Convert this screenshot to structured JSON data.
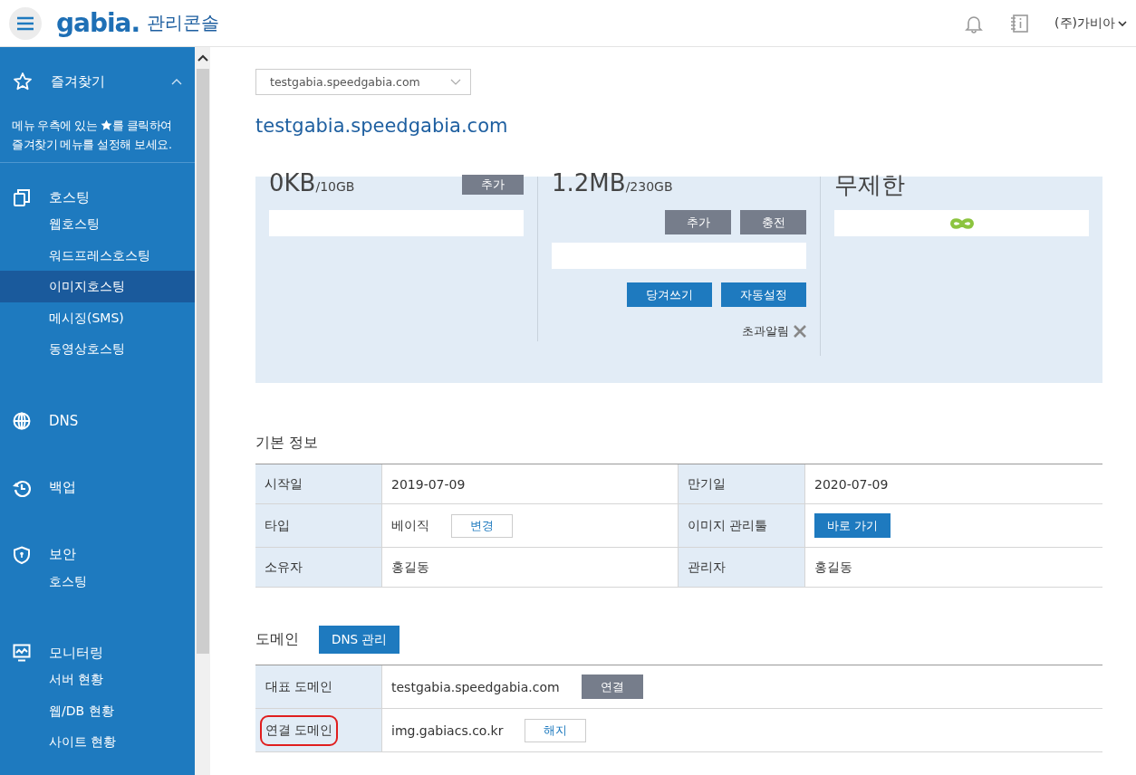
{
  "header": {
    "logo": "gabia.",
    "title": "관리콘솔",
    "user": "(주)가비아"
  },
  "sidebar": {
    "favorites": {
      "label": "즐겨찾기",
      "expanded": true,
      "hint_before": "메뉴 우측에 있는 ",
      "hint_after": "를 클릭하여 즐겨찾기 메뉴를 설정해 보세요."
    },
    "groups": [
      {
        "kind": "hosting",
        "label": "호스팅",
        "items": [
          {
            "label": "웹호스팅",
            "selected": false
          },
          {
            "label": "워드프레스호스팅",
            "selected": false
          },
          {
            "label": "이미지호스팅",
            "selected": true
          },
          {
            "label": "메시징(SMS)",
            "selected": false
          },
          {
            "label": "동영상호스팅",
            "selected": false
          }
        ]
      },
      {
        "kind": "globe",
        "label": "DNS"
      },
      {
        "kind": "history",
        "label": "백업"
      },
      {
        "kind": "shield",
        "label": "보안",
        "items": [
          {
            "label": "호스팅",
            "selected": false
          }
        ]
      },
      {
        "kind": "monitor",
        "label": "모니터링",
        "items": [
          {
            "label": "서버 현황",
            "selected": false
          },
          {
            "label": "웹/DB 현황",
            "selected": false
          },
          {
            "label": "사이트 현황",
            "selected": false
          }
        ]
      }
    ]
  },
  "site_select": {
    "value": "testgabia.speedgabia.com"
  },
  "page_title": "testgabia.speedgabia.com",
  "usage": [
    {
      "amount": "0KB",
      "total": "/10GB",
      "buttons_top": [
        "추가"
      ],
      "kind": "bar"
    },
    {
      "amount": "1.2MB",
      "total": "/230GB",
      "kind": "bar",
      "actions": [
        "추가",
        "충전"
      ],
      "buttons": [
        "당겨쓰기",
        "자동설정"
      ],
      "note": "초과알림"
    },
    {
      "amount": "무제한",
      "kind": "infinite"
    }
  ],
  "basic_info": {
    "title": "기본 정보",
    "rows": [
      [
        {
          "label": "시작일",
          "value": "2019-07-09"
        },
        {
          "label": "만기일",
          "value": "2020-07-09"
        }
      ],
      [
        {
          "label": "타입",
          "value": "베이직",
          "button": "변경",
          "kind": "outline"
        },
        {
          "label": "이미지 관리툴",
          "button": "바로 가기",
          "kind": "primary"
        }
      ],
      [
        {
          "label": "소유자",
          "value": "홍길동"
        },
        {
          "label": "관리자",
          "value": "홍길동"
        }
      ]
    ]
  },
  "domain": {
    "title": "도메인",
    "button": "DNS 관리",
    "rows": [
      {
        "label": "대표 도메인",
        "value": "testgabia.speedgabia.com",
        "button": "연결",
        "kind": "dark",
        "highlighted": false
      },
      {
        "label": "연결 도메인",
        "value": "img.gabiacs.co.kr",
        "button": "해지",
        "kind": "outline",
        "highlighted": true
      }
    ]
  }
}
